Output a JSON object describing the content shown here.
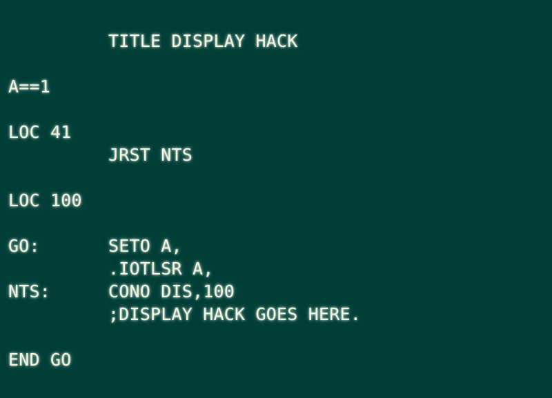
{
  "terminal": {
    "lines": [
      {
        "label": "",
        "code": "TITLE DISPLAY HACK"
      },
      {
        "label": "A==1",
        "code": ""
      },
      {
        "label": "LOC 41",
        "code": ""
      },
      {
        "label": "",
        "code": "JRST NTS"
      },
      {
        "label": "LOC 100",
        "code": ""
      },
      {
        "label": "GO:",
        "code": "SETO A,"
      },
      {
        "label": "",
        "code": ".IOTLSR A,"
      },
      {
        "label": "NTS:",
        "code": "CONO DIS,100"
      },
      {
        "label": "",
        "code": ";DISPLAY HACK GOES HERE."
      },
      {
        "label": "END GO",
        "code": ""
      }
    ]
  }
}
